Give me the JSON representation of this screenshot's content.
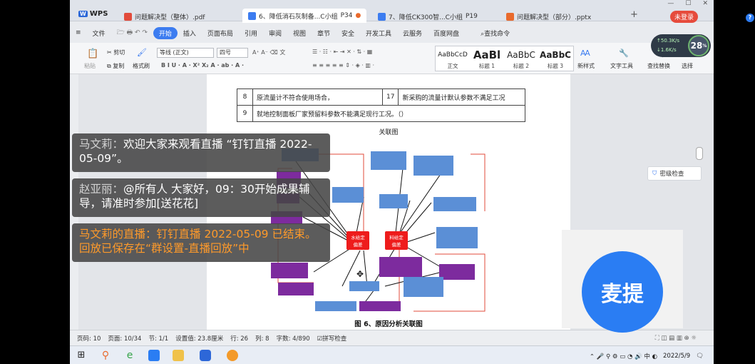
{
  "app": {
    "name": "WPS",
    "login_label": "未登录",
    "tabs": [
      {
        "label": "问题解决型（整体）.pdf",
        "color": "#e24b3b"
      },
      {
        "label": "6、降低消石灰制备...C小组",
        "page": "P34",
        "color": "#3c7cf0"
      },
      {
        "label": "7、降低CK300智...C小组",
        "page": "P19",
        "color": "#3c7cf0"
      },
      {
        "label": "问题解决型（部分）.pptx",
        "color": "#e96a2c"
      }
    ]
  },
  "menu": {
    "items": [
      "文件",
      "开始",
      "插入",
      "页面布局",
      "引用",
      "审阅",
      "视图",
      "章节",
      "安全",
      "开发工具",
      "云服务",
      "百度网盘"
    ],
    "search": "查找命令"
  },
  "ribbon": {
    "cut": "剪切",
    "copy": "复制",
    "format_painter": "格式刷",
    "paste": "粘贴",
    "font": "等线 (正文)",
    "size": "四号",
    "styles": [
      {
        "preview": "AaBbCcD",
        "label": "正文"
      },
      {
        "preview": "AaBl",
        "label": "标题 1"
      },
      {
        "preview": "AaBbC",
        "label": "标题 2"
      },
      {
        "preview": "AaBbC",
        "label": "标题 3"
      }
    ],
    "new_style": "新样式",
    "text_tool": "文字工具",
    "find_replace": "查找替换",
    "select": "选择"
  },
  "document": {
    "table_rows": [
      {
        "no": "8",
        "text": "原流量计不符合使用场合，",
        "no2": "17",
        "text2": "新采购的流量计默认参数不满足工况"
      },
      {
        "no": "9",
        "text": "就地控制面板厂家预留料参数不能满足现行工况。（）",
        "no2": "",
        "text2": ""
      }
    ],
    "figure_heading": "关联图",
    "figure_caption": "图 6、原因分析关联图",
    "diagram": {
      "center_left": "水给定偏差",
      "center_right": "料给定偏差"
    }
  },
  "side": {
    "secret_check": "密级检查"
  },
  "statusbar": {
    "page": "页码: 10",
    "pages": "页面: 10/34",
    "section": "节: 1/1",
    "setting": "设置值: 23.8厘米",
    "row": "行: 26",
    "col": "列: 8",
    "words": "字数: 4/890",
    "spell": "拼写检查"
  },
  "chat": [
    {
      "who": "马文莉",
      "text": "欢迎大家来观看直播 “钉钉直播 2022-05-09”。"
    },
    {
      "who": "赵亚丽",
      "text": "@所有人 大家好，09：30开始成果辅导，请准时参加[送花花]"
    },
    {
      "who": "马文莉的直播",
      "text": "钉钉直播 2022-05-09 已结束。回放已保存在“群设置-直播回放”中"
    }
  ],
  "mic": {
    "label": "麦提"
  },
  "network": {
    "up": "50.3K/s",
    "down": "1.6K/s",
    "percent": "28"
  },
  "taskbar": {
    "date": "2022/5/9"
  }
}
